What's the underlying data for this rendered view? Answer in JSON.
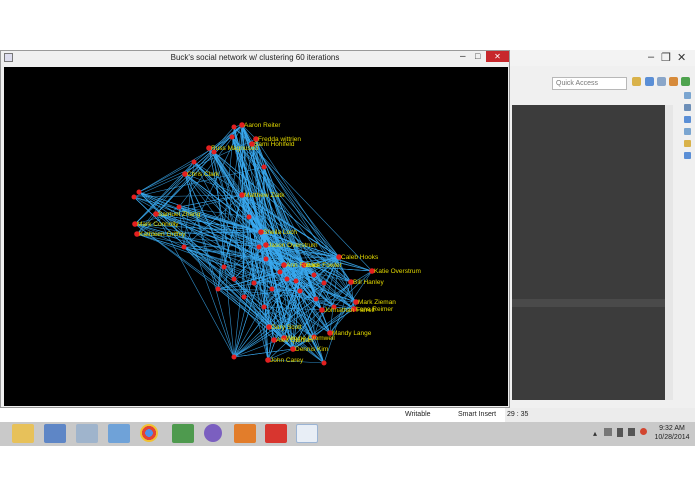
{
  "java_window": {
    "title": "Buck's social network w/ clustering 60 iterations",
    "minimize": "–",
    "maximize": "□",
    "close": "✕"
  },
  "eclipse": {
    "minimize": "–",
    "restore": "❐",
    "close": "✕",
    "quick_access_placeholder": "Quick Access",
    "status": {
      "mode": "Writable",
      "insert": "Smart Insert",
      "position": "29 : 35"
    }
  },
  "graph": {
    "nodes": [
      {
        "label": "Aaron Reiter"
      },
      {
        "label": "Fredda wittrien"
      },
      {
        "label": "Sami Hohlfeld"
      },
      {
        "label": "Russ Magnuson"
      },
      {
        "label": "Chris Clark"
      },
      {
        "label": "Matthew Ziatk"
      },
      {
        "label": "Samuel Zhang"
      },
      {
        "label": "Mark Connolly"
      },
      {
        "label": "Kathleen Griffey"
      },
      {
        "label": "Sheila Loch"
      },
      {
        "label": "Jason Overstrum"
      },
      {
        "label": "Caleb Hooks"
      },
      {
        "label": "Katie Overstrum"
      },
      {
        "label": "Bill Hanley"
      },
      {
        "label": "Mark Zieman"
      },
      {
        "label": "Lena Reimer"
      },
      {
        "label": "Johnathan Farrell"
      },
      {
        "label": "Gary Scott"
      },
      {
        "label": "Mandy Lange"
      },
      {
        "label": "Wayne Cromwell"
      },
      {
        "label": "Alex Quinlan"
      },
      {
        "label": "Dennis Kim"
      },
      {
        "label": "John Carey"
      },
      {
        "label": "Buck Fowler"
      },
      {
        "label": "Ann Fowler"
      }
    ],
    "colors": {
      "background": "#000000",
      "edge": "#39a9f0",
      "node": "#e32020",
      "label": "#e3d900"
    }
  },
  "taskbar": {
    "apps": [
      "file-explorer-icon",
      "control-panel-icon",
      "photos-icon",
      "network-icon",
      "chrome-icon",
      "notepad-icon",
      "media-icon",
      "settings-icon",
      "swift-icon",
      "java-icon"
    ],
    "time": "9:32 AM",
    "date": "10/28/2014"
  }
}
